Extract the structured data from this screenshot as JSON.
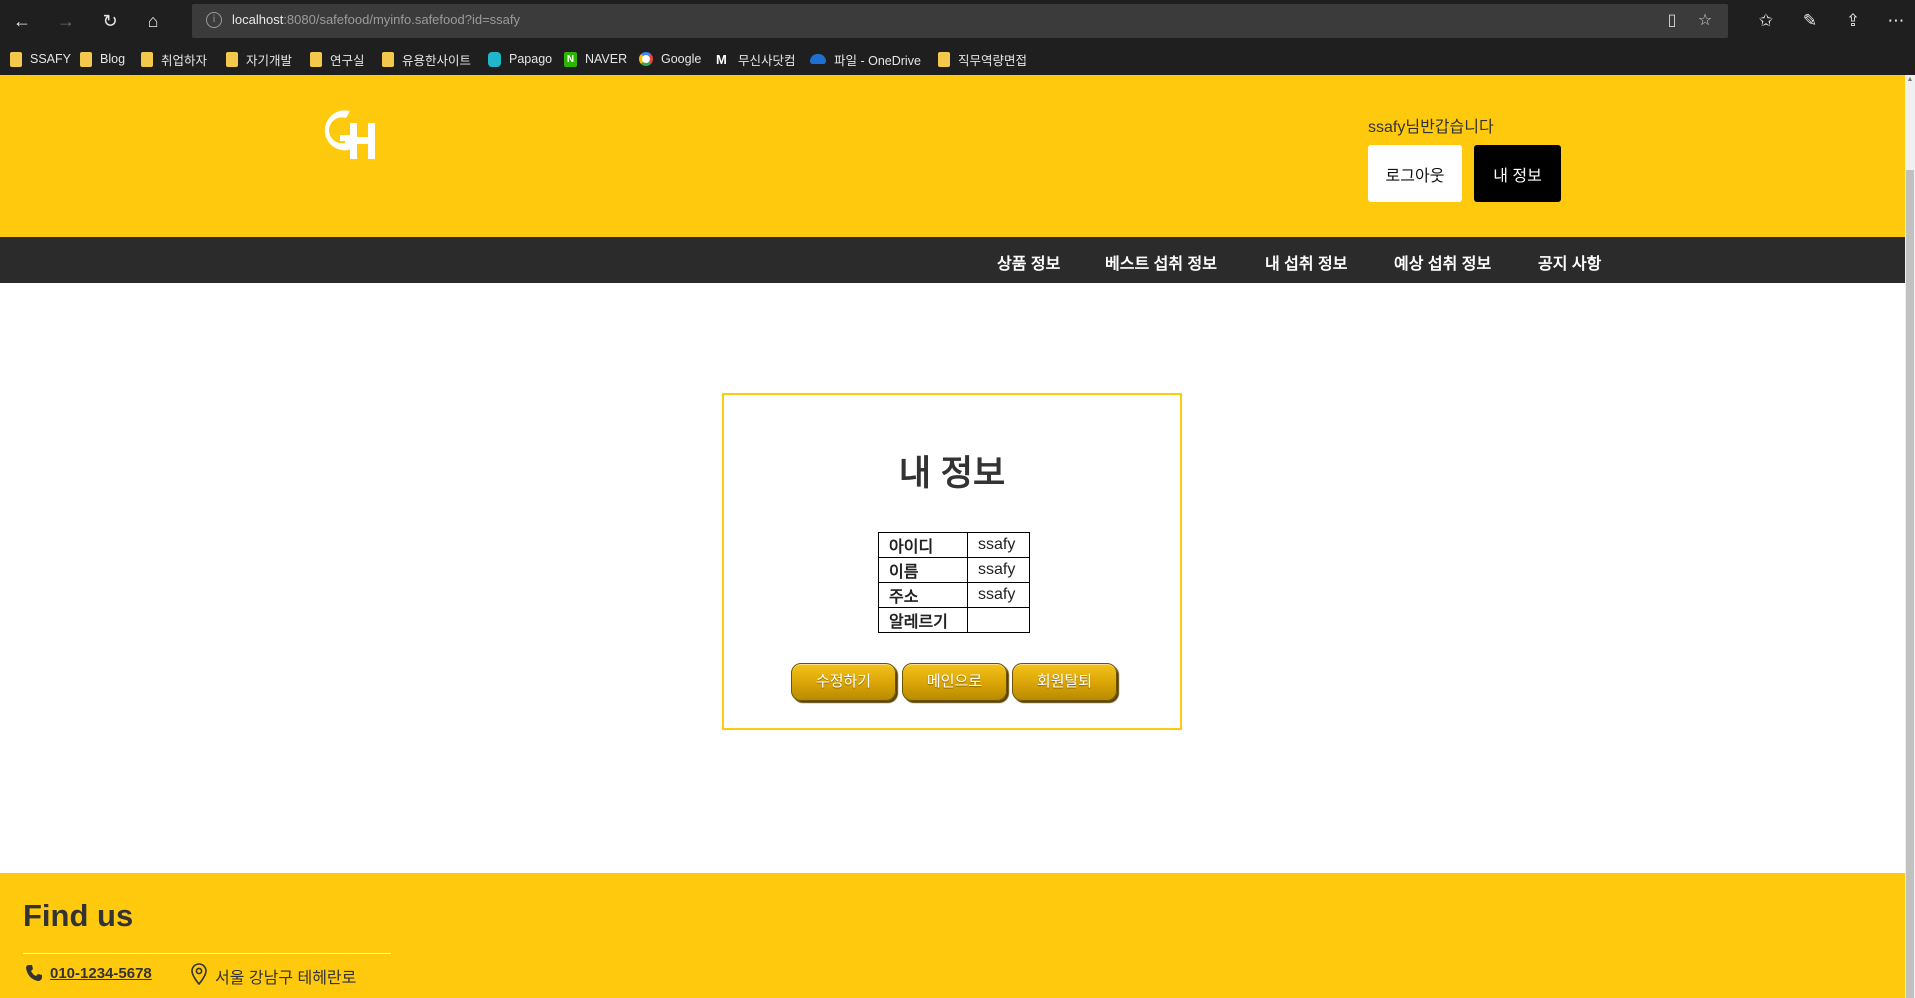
{
  "browser": {
    "url_host": "localhost",
    "url_rest": ":8080/safefood/myinfo.safefood?id=ssafy",
    "bookmarks": [
      "SSAFY",
      "Blog",
      "취업하자",
      "자기개발",
      "연구실",
      "유용한사이트",
      "Papago",
      "NAVER",
      "Google",
      "무신사닷컴",
      "파일 - OneDrive",
      "직무역량면접"
    ]
  },
  "header": {
    "greeting": "ssafy님반갑습니다",
    "logout_label": "로그아웃",
    "myinfo_label": "내 정보"
  },
  "nav": {
    "items": [
      "상품 정보",
      "베스트 섭취 정보",
      "내 섭취 정보",
      "예상 섭취 정보",
      "공지 사항"
    ]
  },
  "card": {
    "title": "내 정보",
    "rows": [
      {
        "label": "아이디",
        "value": "ssafy"
      },
      {
        "label": "이름",
        "value": "ssafy"
      },
      {
        "label": "주소",
        "value": "ssafy"
      },
      {
        "label": "알레르기",
        "value": ""
      }
    ],
    "buttons": [
      "수정하기",
      "메인으로",
      "회원탈퇴"
    ]
  },
  "footer": {
    "heading": "Find us",
    "phone": "010-1234-5678",
    "address": "서울 강남구 테헤란로"
  },
  "colors": {
    "brand_yellow": "#ffc90e",
    "nav_dark": "#2b2b2b",
    "browser_dark": "#1f1f1f"
  }
}
